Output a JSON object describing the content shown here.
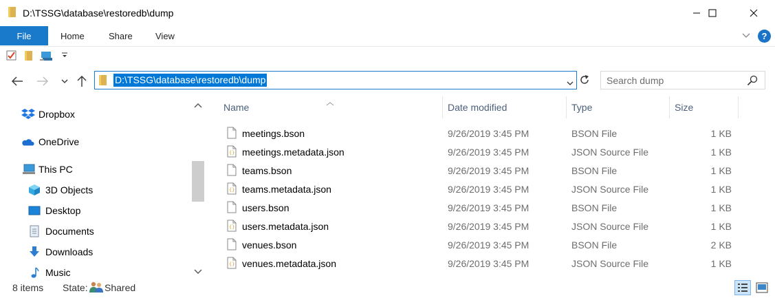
{
  "window": {
    "title": "D:\\TSSG\\database\\restoredb\\dump"
  },
  "ribbon": {
    "tabs": [
      "File",
      "Home",
      "Share",
      "View"
    ],
    "help_label": "?"
  },
  "address": {
    "path": "D:\\TSSG\\database\\restoredb\\dump"
  },
  "search": {
    "placeholder": "Search dump"
  },
  "navigation": {
    "items": [
      {
        "label": "Dropbox",
        "icon": "dropbox-icon"
      },
      {
        "label": "OneDrive",
        "icon": "onedrive-icon"
      },
      {
        "label": "This PC",
        "icon": "this-pc-icon"
      },
      {
        "label": "3D Objects",
        "icon": "3d-objects-icon"
      },
      {
        "label": "Desktop",
        "icon": "desktop-icon"
      },
      {
        "label": "Documents",
        "icon": "documents-icon"
      },
      {
        "label": "Downloads",
        "icon": "downloads-icon"
      },
      {
        "label": "Music",
        "icon": "music-icon"
      }
    ]
  },
  "columns": {
    "name": "Name",
    "date": "Date modified",
    "type": "Type",
    "size": "Size"
  },
  "files": [
    {
      "name": "meetings.bson",
      "date": "9/26/2019 3:45 PM",
      "type": "BSON File",
      "size": "1 KB",
      "icon": "file-icon"
    },
    {
      "name": "meetings.metadata.json",
      "date": "9/26/2019 3:45 PM",
      "type": "JSON Source File",
      "size": "1 KB",
      "icon": "json-file-icon"
    },
    {
      "name": "teams.bson",
      "date": "9/26/2019 3:45 PM",
      "type": "BSON File",
      "size": "1 KB",
      "icon": "file-icon"
    },
    {
      "name": "teams.metadata.json",
      "date": "9/26/2019 3:45 PM",
      "type": "JSON Source File",
      "size": "1 KB",
      "icon": "json-file-icon"
    },
    {
      "name": "users.bson",
      "date": "9/26/2019 3:45 PM",
      "type": "BSON File",
      "size": "1 KB",
      "icon": "file-icon"
    },
    {
      "name": "users.metadata.json",
      "date": "9/26/2019 3:45 PM",
      "type": "JSON Source File",
      "size": "1 KB",
      "icon": "json-file-icon"
    },
    {
      "name": "venues.bson",
      "date": "9/26/2019 3:45 PM",
      "type": "BSON File",
      "size": "2 KB",
      "icon": "file-icon"
    },
    {
      "name": "venues.metadata.json",
      "date": "9/26/2019 3:45 PM",
      "type": "JSON Source File",
      "size": "1 KB",
      "icon": "json-file-icon"
    }
  ],
  "status": {
    "item_count": "8 items",
    "state_label": "State:",
    "shared_label": "Shared"
  },
  "colors": {
    "accent": "#1979ca",
    "selection": "#0078d7",
    "header_text": "#4c607a",
    "detail_text": "#6d6d6d"
  }
}
